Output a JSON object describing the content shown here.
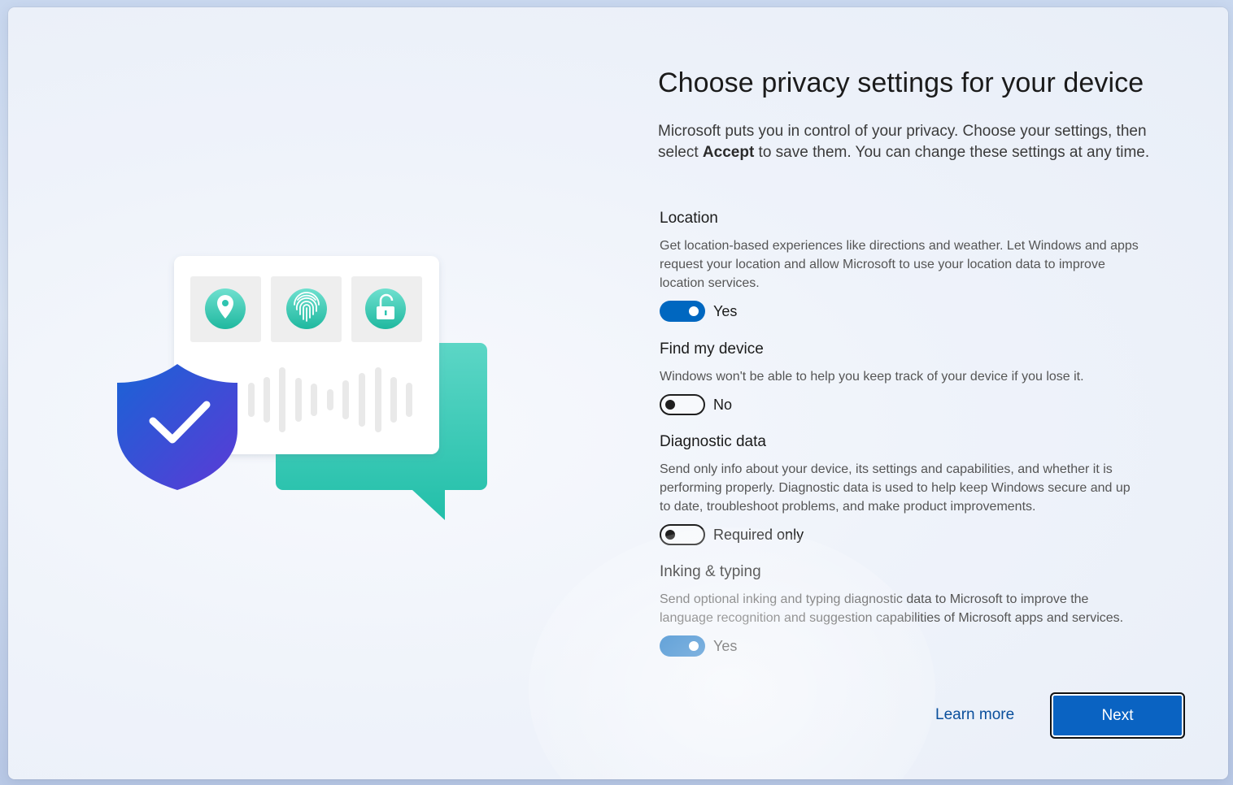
{
  "page": {
    "title": "Choose privacy settings for your device",
    "intro_pre": "Microsoft puts you in control of your privacy. Choose your settings, then select ",
    "intro_bold": "Accept",
    "intro_post": " to save them. You can change these settings at any time."
  },
  "settings": [
    {
      "title": "Location",
      "description": "Get location-based experiences like directions and weather. Let Windows and apps request your location and allow Microsoft to use your location data to improve location services.",
      "state": "on",
      "value_label": "Yes"
    },
    {
      "title": "Find my device",
      "description": "Windows won't be able to help you keep track of your device if you lose it.",
      "state": "off",
      "value_label": "No"
    },
    {
      "title": "Diagnostic data",
      "description": "Send only info about your device, its settings and capabilities, and whether it is performing properly. Diagnostic data is used to help keep Windows secure and up to date, troubleshoot problems, and make product improvements.",
      "state": "off",
      "value_label": "Required only"
    },
    {
      "title": "Inking & typing",
      "description": "Send optional inking and typing diagnostic data to Microsoft to improve the language recognition and suggestion capabilities of Microsoft apps and services.",
      "state": "on",
      "value_label": "Yes"
    }
  ],
  "footer": {
    "learn_more": "Learn more",
    "next": "Next"
  },
  "illustration": {
    "icons": [
      "location-pin-icon",
      "fingerprint-icon",
      "unlock-icon",
      "shield-check-icon",
      "chat-bubble-icon",
      "voice-waveform-icon"
    ],
    "colors": {
      "teal": "#2ec4b0",
      "shield_top": "#1e5fd6",
      "shield_bottom": "#5a3fd8",
      "accent": "#0067c0"
    }
  }
}
